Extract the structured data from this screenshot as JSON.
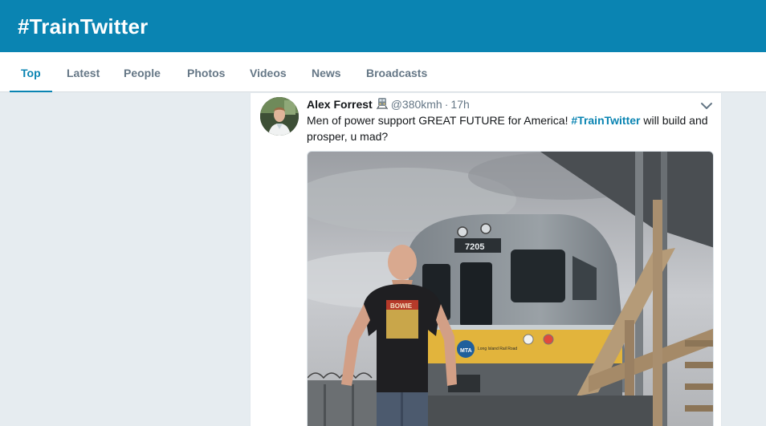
{
  "header": {
    "title": "#TrainTwitter"
  },
  "tabs": [
    {
      "label": "Top",
      "active": true
    },
    {
      "label": "Latest"
    },
    {
      "label": "People"
    },
    {
      "label": "Photos"
    },
    {
      "label": "Videos"
    },
    {
      "label": "News"
    },
    {
      "label": "Broadcasts"
    }
  ],
  "tweet": {
    "fullname": "Alex Forrest",
    "badge_icon": "train-emoji-icon",
    "username": "@380kmh",
    "separator": "·",
    "time": "17h",
    "text_before": "Men of power support GREAT FUTURE for America! ",
    "hashtag": "#TrainTwitter",
    "text_after": " will build and prosper, u mad?",
    "media": {
      "train_number": "7205",
      "shirt_text": "BOWIE",
      "logo_text": "MTA",
      "railroad_text": "Long Island Rail Road"
    }
  },
  "colors": {
    "brand": "#0a84b2",
    "background": "#e6ecf0",
    "text": "#14171a",
    "muted": "#657786"
  }
}
